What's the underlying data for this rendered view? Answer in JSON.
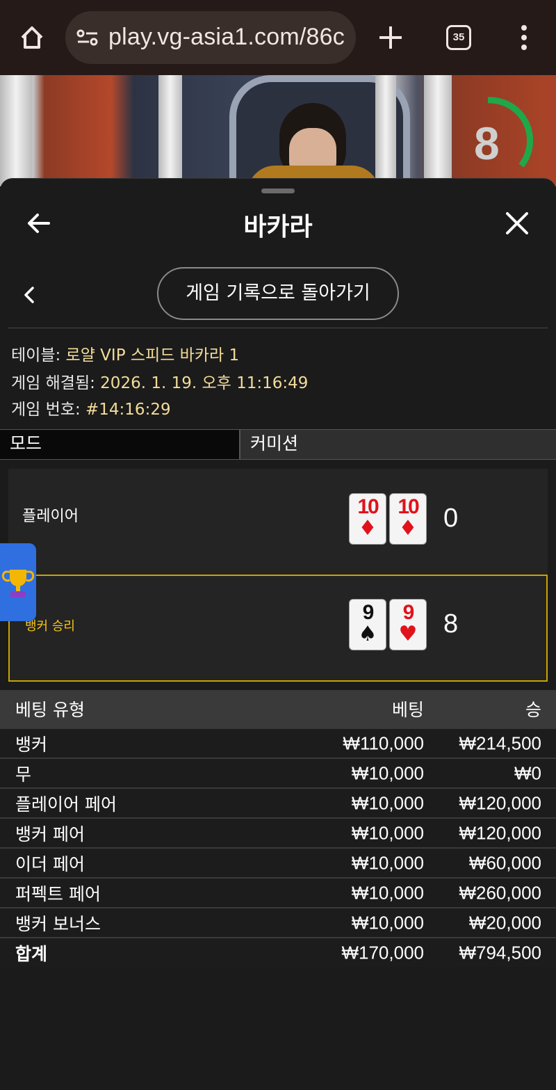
{
  "browser": {
    "url": "play.vg-asia1.com/86c",
    "tab_count": "35",
    "icons": [
      "home-icon",
      "site-settings-icon",
      "plus-icon",
      "tab-switcher-icon",
      "more-vert-icon"
    ]
  },
  "video": {
    "timer_value": "8",
    "timer_color": "#1fa84a"
  },
  "sheet": {
    "title": "바카라",
    "back_to_history_label": "게임 기록으로 돌아가기"
  },
  "info": {
    "table_label": "테이블: ",
    "table_value": "로얄 VIP 스피드 바카라 1",
    "resolved_label": "게임 해결됨: ",
    "resolved_value": "2026. 1. 19. 오후 11:16:49",
    "game_no_label": "게임 번호: ",
    "game_no_value": "#14:16:29"
  },
  "mode": {
    "label": "모드",
    "value": "커미션"
  },
  "result": {
    "player": {
      "label": "플레이어",
      "score": "0",
      "cards": [
        {
          "rank": "10",
          "suit": "♦",
          "color": "red"
        },
        {
          "rank": "10",
          "suit": "♦",
          "color": "red"
        }
      ]
    },
    "banker": {
      "label": "뱅커 승리",
      "score": "8",
      "cards": [
        {
          "rank": "9",
          "suit": "♠",
          "color": "black"
        },
        {
          "rank": "9",
          "suit": "♥",
          "color": "red"
        }
      ]
    },
    "highlight_color": "#c9a500"
  },
  "bets": {
    "headers": {
      "type": "베팅 유형",
      "bet": "베팅",
      "win": "승"
    },
    "rows": [
      {
        "type": "뱅커",
        "bet": "₩110,000",
        "win": "₩214,500"
      },
      {
        "type": "무",
        "bet": "₩10,000",
        "win": "₩0"
      },
      {
        "type": "플레이어 페어",
        "bet": "₩10,000",
        "win": "₩120,000"
      },
      {
        "type": "뱅커 페어",
        "bet": "₩10,000",
        "win": "₩120,000"
      },
      {
        "type": "이더 페어",
        "bet": "₩10,000",
        "win": "₩60,000"
      },
      {
        "type": "퍼펙트 페어",
        "bet": "₩10,000",
        "win": "₩260,000"
      },
      {
        "type": "뱅커 보너스",
        "bet": "₩10,000",
        "win": "₩20,000"
      }
    ],
    "total": {
      "type": "합계",
      "bet": "₩170,000",
      "win": "₩794,500"
    }
  }
}
